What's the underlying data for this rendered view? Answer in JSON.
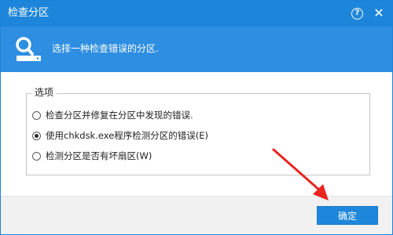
{
  "window": {
    "title": "检查分区",
    "help_glyph": "?",
    "close_glyph": "✕"
  },
  "banner": {
    "icon": "search-icon",
    "text": "选择一种检查错误的分区."
  },
  "options_group": {
    "legend": "选项",
    "items": [
      {
        "label": "检查分区并修复在分区中发现的错误.",
        "checked": false
      },
      {
        "label": "使用chkdsk.exe程序检测分区的错误(E)",
        "checked": true
      },
      {
        "label": "检测分区是否有坏扇区(W)",
        "checked": false
      }
    ]
  },
  "ok_button": {
    "label": "确定"
  },
  "colors": {
    "titlebar": "#1d86da",
    "banner": "#2e8ee1",
    "button": "#1f87db",
    "annotation_arrow": "#e8251f"
  }
}
